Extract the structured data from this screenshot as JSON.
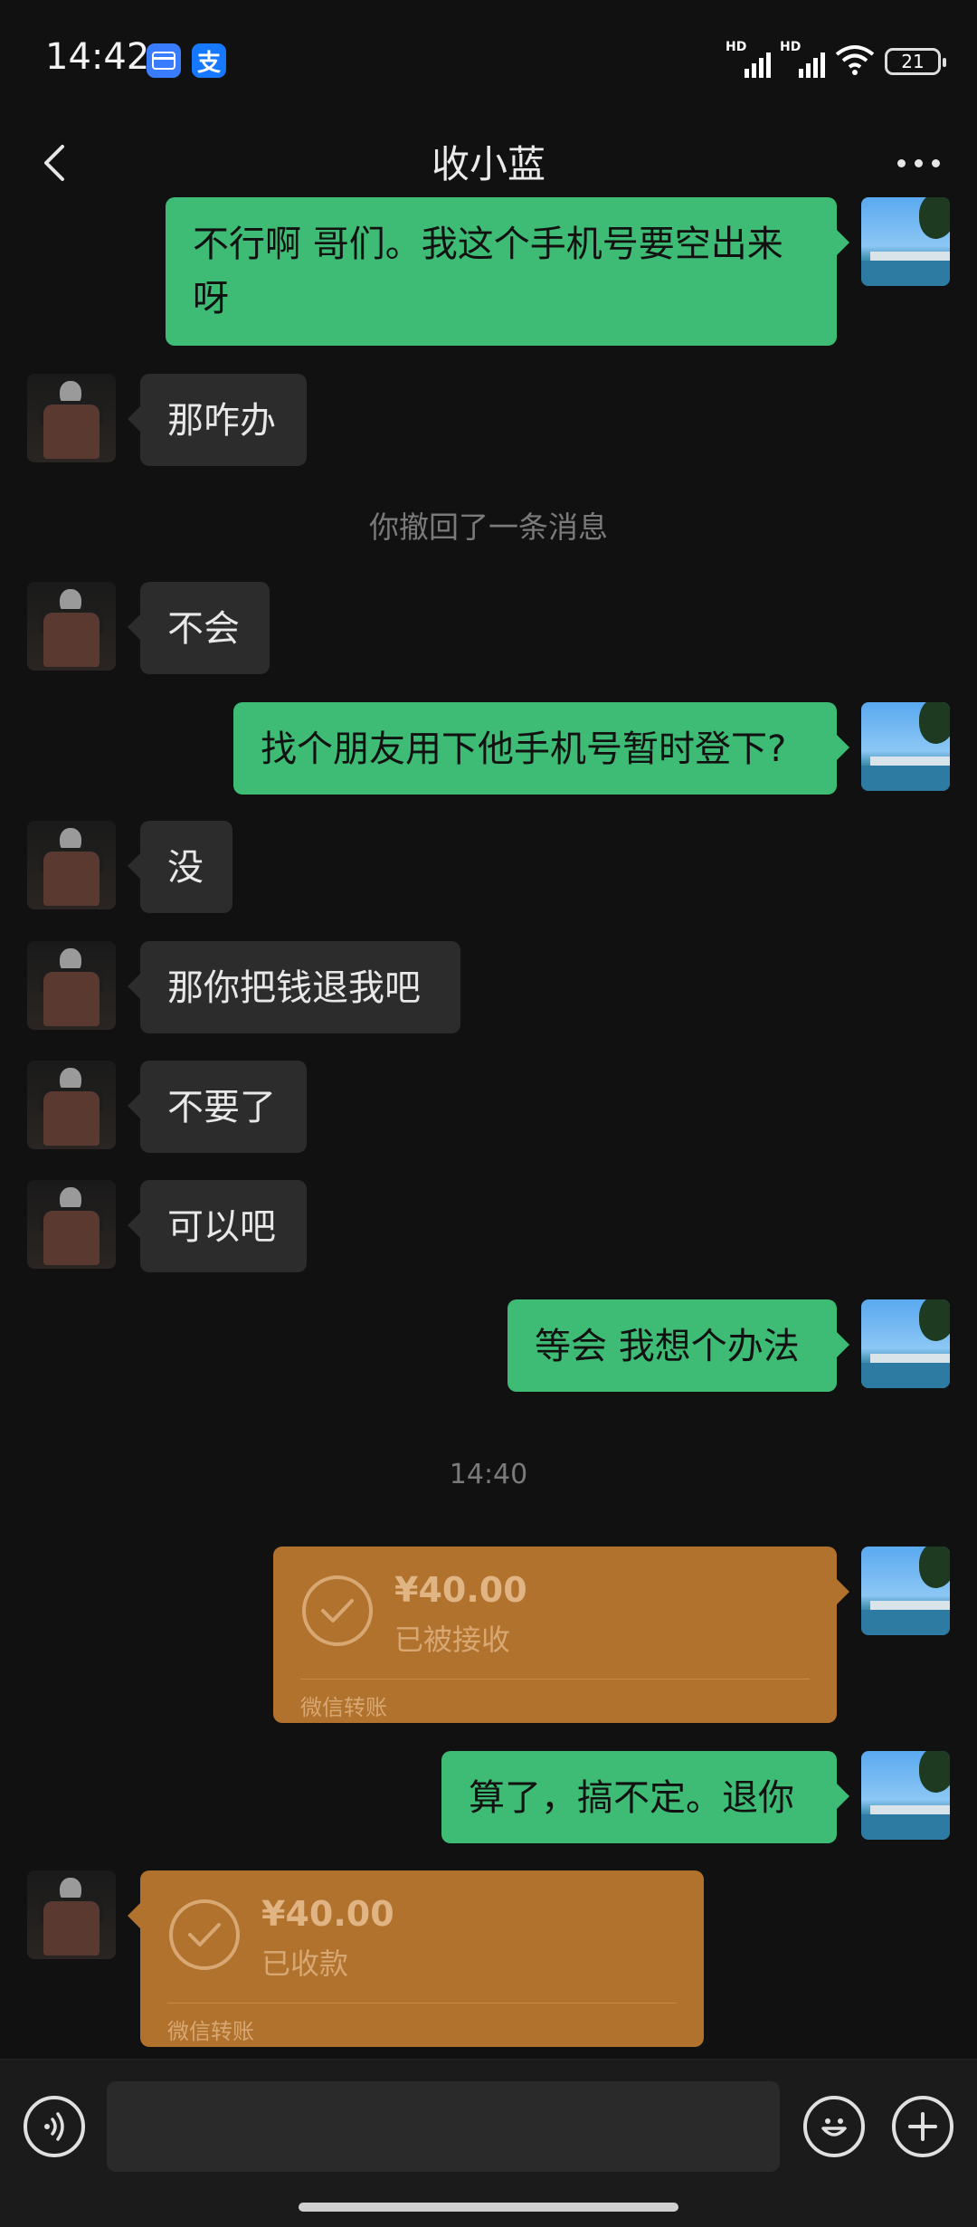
{
  "status_bar": {
    "time": "14:42",
    "app_icons": [
      "card-icon",
      "alipay-icon"
    ],
    "alipay_glyph": "支",
    "signal_label": "HD",
    "battery": "21"
  },
  "nav": {
    "title": "收小蓝",
    "back_icon": "chevron-left-icon",
    "more_icon": "more-dots-icon"
  },
  "messages": [
    {
      "type": "out",
      "text_line1": "不行啊 哥们。我这个手机号要空出来",
      "text_line2": "呀"
    },
    {
      "type": "in",
      "text": "那咋办"
    },
    {
      "type": "system",
      "text": "你撤回了一条消息"
    },
    {
      "type": "in",
      "text": "不会"
    },
    {
      "type": "out",
      "text": "找个朋友用下他手机号暂时登下?"
    },
    {
      "type": "in",
      "text": "没"
    },
    {
      "type": "in",
      "text": "那你把钱退我吧"
    },
    {
      "type": "in",
      "text": "不要了"
    },
    {
      "type": "in",
      "text": "可以吧"
    },
    {
      "type": "out",
      "text": "等会 我想个办法"
    },
    {
      "type": "time",
      "text": "14:40"
    },
    {
      "type": "transfer_out",
      "amount": "¥40.00",
      "status": "已被接收",
      "footer": "微信转账"
    },
    {
      "type": "out",
      "text": "算了，搞不定。退你"
    },
    {
      "type": "transfer_in",
      "amount": "¥40.00",
      "status": "已收款",
      "footer": "微信转账"
    }
  ],
  "input_bar": {
    "voice_icon": "voice-icon",
    "emoji_icon": "emoji-icon",
    "plus_icon": "plus-icon",
    "input_value": ""
  },
  "colors": {
    "background": "#111111",
    "outgoing_bubble": "#3ebb74",
    "incoming_bubble": "#2c2c2c",
    "transfer_card": "#b0722d"
  }
}
